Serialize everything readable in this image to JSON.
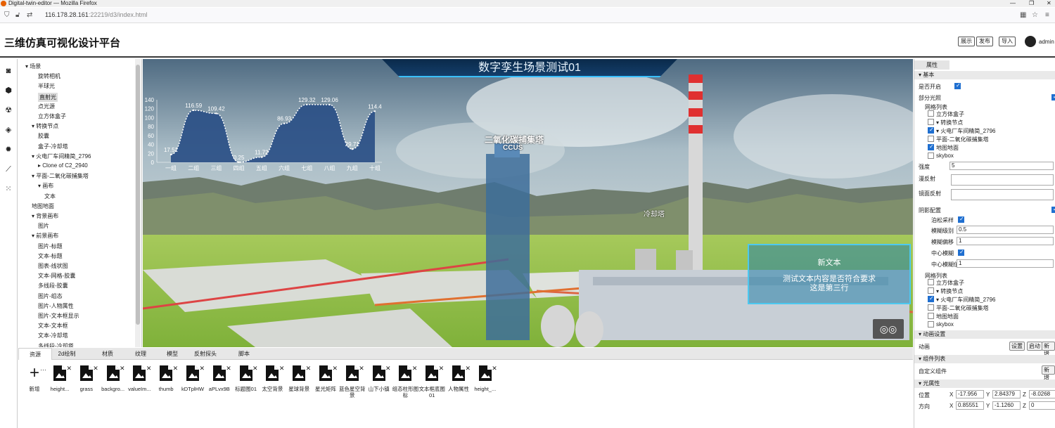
{
  "window": {
    "title": "Digital-twin-editor — Mozilla Firefox",
    "url_host": "116.178.28.161",
    "url_path": ":22219/d3/index.html"
  },
  "header": {
    "title": "三维仿真可视化设计平台",
    "buttons": [
      "展示",
      "发布",
      "导入"
    ],
    "user": "admin"
  },
  "tree": [
    {
      "label": "▾ 场景",
      "indent": 0
    },
    {
      "label": "旋转相机",
      "indent": 2
    },
    {
      "label": "半球光",
      "indent": 2
    },
    {
      "label": "直射光",
      "indent": 2,
      "selected": true
    },
    {
      "label": "点光源",
      "indent": 2
    },
    {
      "label": "立方体盒子",
      "indent": 2
    },
    {
      "label": "▾ 转换节点",
      "indent": 1
    },
    {
      "label": "胶囊",
      "indent": 2
    },
    {
      "label": "盒子-冷却塔",
      "indent": 2
    },
    {
      "label": "▾ 火电厂车间精简_2796",
      "indent": 1
    },
    {
      "label": "▸ Clone of C2_2940",
      "indent": 2
    },
    {
      "label": "▾ 平面-二氧化碳捕集塔",
      "indent": 1
    },
    {
      "label": "▾ 画布",
      "indent": 2
    },
    {
      "label": "文本",
      "indent": 3
    },
    {
      "label": "地图地面",
      "indent": 1
    },
    {
      "label": "▾ 背景画布",
      "indent": 1
    },
    {
      "label": "图片",
      "indent": 2
    },
    {
      "label": "▾ 前景画布",
      "indent": 1
    },
    {
      "label": "图片-标题",
      "indent": 2
    },
    {
      "label": "文本-标题",
      "indent": 2
    },
    {
      "label": "图表-线状图",
      "indent": 2
    },
    {
      "label": "文本-网格-胶囊",
      "indent": 2
    },
    {
      "label": "多线段-胶囊",
      "indent": 2
    },
    {
      "label": "图片-组态",
      "indent": 2
    },
    {
      "label": "图片-人物属性",
      "indent": 2
    },
    {
      "label": "图片-文本框显示",
      "indent": 2
    },
    {
      "label": "文本-文本框",
      "indent": 2
    },
    {
      "label": "文本-冷却塔",
      "indent": 2
    },
    {
      "label": "多线段-冷却塔",
      "indent": 2
    }
  ],
  "viewport": {
    "banner": "数字孪生场景测试01",
    "tower_label_1": "二氧化碳捕集塔",
    "tower_label_2": "CCUS",
    "cooling_label": "冷却塔",
    "popup_title": "新文本",
    "popup_line1": "测试文本内容是否符合要求",
    "popup_line2": "这是第三行"
  },
  "chart_data": {
    "type": "area",
    "categories": [
      "一组",
      "二组",
      "三组",
      "四组",
      "五组",
      "六组",
      "七组",
      "八组",
      "九组",
      "十组"
    ],
    "values": [
      17.51,
      116.59,
      109.42,
      0.25,
      11.72,
      86.93,
      129.32,
      129.06,
      29.71,
      114.4
    ],
    "value_labels": [
      "17.51",
      "116.59",
      "109.42",
      "0.25",
      "11.72",
      "86.93",
      "129.32",
      "129.06",
      "29.71",
      "114.4"
    ],
    "yticks": [
      "0",
      "20",
      "40",
      "60",
      "80",
      "100",
      "120",
      "140"
    ],
    "ylim": [
      0,
      140
    ],
    "fill": "#2a4f86"
  },
  "bottom": {
    "tabs": [
      "资源",
      "2d绘制",
      "材质",
      "纹理",
      "模型",
      "反射探头",
      "脚本"
    ],
    "add_label": "新增",
    "assets": [
      "height...",
      "grass",
      "backgro...",
      "valueIm...",
      "thumb",
      "kDTplHW",
      "aPLvx9B",
      "标题图01",
      "太空背景",
      "星球背景",
      "星光矩阵",
      "蓝色星空背景",
      "山下小镇",
      "组态柱形图标",
      "文本框底图01",
      "人物属性",
      "height_..."
    ]
  },
  "props": {
    "tab": "属性",
    "basic": "基本",
    "enabled": "是否开启",
    "partial_light": "部分光照",
    "grid_list": "网格列表",
    "grid_items_1": [
      "立方体盒子",
      "▾ 转换节点",
      "▾ 火电厂车间精简_2796",
      "平面-二氧化碳捕集塔",
      "地图地面",
      "skybox"
    ],
    "grid_checked_1": [
      false,
      false,
      true,
      false,
      true,
      false
    ],
    "strength": "强度",
    "strength_val": "5",
    "diffuse": "漫反射",
    "specular": "镜面反射",
    "shadow": "阴影配置",
    "poisson": "泊松采样",
    "blur_level": "模糊级别",
    "blur_level_val": "0.5",
    "blur_offset": "模糊偏移",
    "blur_offset_val": "1",
    "center_blur": "中心模糊",
    "center_blur_val_label": "中心模糊值",
    "center_blur_val": "1",
    "grid_items_2": [
      "立方体盒子",
      "▾ 转换节点",
      "▾ 火电厂车间精简_2796",
      "平面-二氧化碳捕集塔",
      "地图地面",
      "skybox"
    ],
    "grid_checked_2": [
      false,
      false,
      true,
      false,
      false,
      false
    ],
    "anim_section": "动画设置",
    "anim": "动画",
    "anim_btns": [
      "设置",
      "启动",
      "新增"
    ],
    "comp_section": "组件列表",
    "custom_comp": "自定义组件",
    "comp_new": "新增",
    "light_section": "光属性",
    "pos": "位置",
    "dir": "方向",
    "pos_vals": [
      "-17.956",
      "2.84379",
      "-8.0268"
    ],
    "dir_vals": [
      "0.85551",
      "-1.1260",
      "0"
    ]
  }
}
